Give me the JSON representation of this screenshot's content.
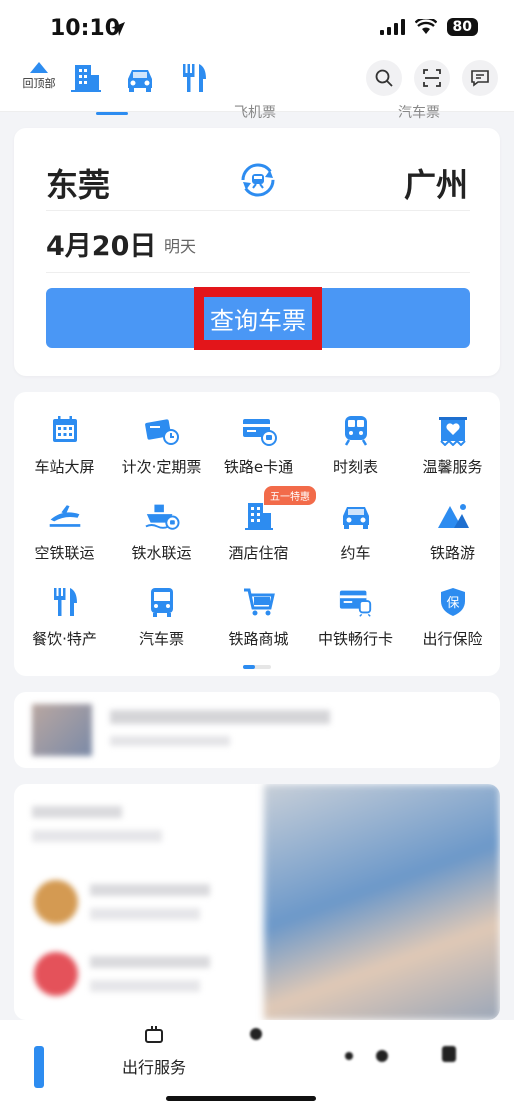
{
  "status_bar": {
    "time": "10:10",
    "battery": "80"
  },
  "top_nav": {
    "back_top_label": "回顶部",
    "icons": [
      "hotel-icon",
      "car-icon",
      "dining-icon"
    ],
    "actions": [
      "search-icon",
      "scan-icon",
      "message-icon"
    ]
  },
  "mode_tabs": [
    "飞机票",
    "汽车票"
  ],
  "ticket": {
    "from_city": "东莞",
    "to_city": "广州",
    "date": "4月20日",
    "day_hint": "明天",
    "search_button": "查询车票"
  },
  "services": [
    {
      "label": "车站大屏",
      "icon": "station-screen-icon"
    },
    {
      "label": "计次·定期票",
      "icon": "periodic-ticket-icon"
    },
    {
      "label": "铁路e卡通",
      "icon": "ecard-icon"
    },
    {
      "label": "时刻表",
      "icon": "timetable-icon"
    },
    {
      "label": "温馨服务",
      "icon": "care-service-icon"
    },
    {
      "label": "空铁联运",
      "icon": "air-rail-icon"
    },
    {
      "label": "铁水联运",
      "icon": "rail-water-icon"
    },
    {
      "label": "酒店住宿",
      "icon": "hotel-icon"
    },
    {
      "label": "约车",
      "icon": "car-icon"
    },
    {
      "label": "铁路游",
      "icon": "rail-tour-icon"
    },
    {
      "label": "餐饮·特产",
      "icon": "dining-icon"
    },
    {
      "label": "汽车票",
      "icon": "bus-icon"
    },
    {
      "label": "铁路商城",
      "icon": "shopping-cart-icon"
    },
    {
      "label": "中铁畅行卡",
      "icon": "travel-card-icon"
    },
    {
      "label": "出行保险",
      "icon": "insurance-icon"
    }
  ],
  "hotel_badge": "五一特惠",
  "tab_bar": {
    "service_label": "出行服务"
  },
  "colors": {
    "primary": "#2d8cf0",
    "button": "#4a97f5",
    "highlight_border": "#e3151a",
    "badge": "#f26b4a"
  }
}
